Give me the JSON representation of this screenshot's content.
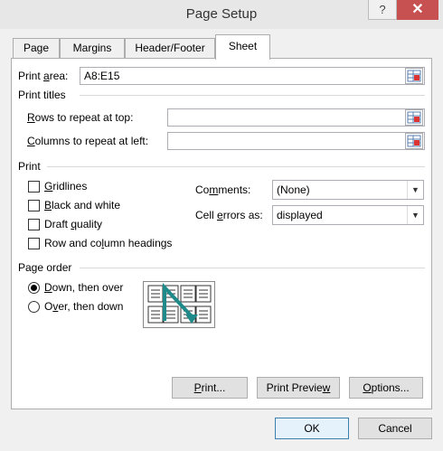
{
  "window": {
    "title": "Page Setup",
    "help_glyph": "?",
    "close_glyph": "✕"
  },
  "tabs": [
    {
      "label": "Page"
    },
    {
      "label": "Margins"
    },
    {
      "label": "Header/Footer"
    },
    {
      "label": "Sheet",
      "active": true
    }
  ],
  "print_area": {
    "label_pre": "Print ",
    "label_u": "a",
    "label_post": "rea:",
    "value": "A8:E15"
  },
  "print_titles": {
    "heading": "Print titles",
    "rows": {
      "label_u": "R",
      "label_post": "ows to repeat at top:",
      "value": ""
    },
    "cols": {
      "label_u": "C",
      "label_post": "olumns to repeat at left:",
      "value": ""
    }
  },
  "print": {
    "heading": "Print",
    "gridlines": {
      "u": "G",
      "rest": "ridlines",
      "checked": false
    },
    "black_white": {
      "u": "B",
      "rest": "lack and white",
      "checked": false
    },
    "draft": {
      "pre": "Draft ",
      "u": "q",
      "rest": "uality",
      "checked": false
    },
    "headings": {
      "pre": "Row and co",
      "u": "l",
      "rest": "umn headings",
      "checked": false
    },
    "comments": {
      "pre": "Co",
      "u": "m",
      "rest": "ments:",
      "value": "(None)"
    },
    "cell_errors": {
      "pre": "Cell ",
      "u": "e",
      "rest": "rrors as:",
      "value": "displayed"
    }
  },
  "page_order": {
    "heading": "Page order",
    "down_over": {
      "u": "D",
      "rest": "own, then over",
      "selected": true
    },
    "over_down": {
      "pre": "O",
      "u": "v",
      "rest": "er, then down",
      "selected": false
    }
  },
  "buttons": {
    "print": {
      "u": "P",
      "rest": "rint..."
    },
    "preview": {
      "pre": "Print Previe",
      "u": "w",
      "rest": ""
    },
    "options": {
      "u": "O",
      "rest": "ptions..."
    },
    "ok": "OK",
    "cancel": "Cancel"
  },
  "colors": {
    "close_bg": "#c75050",
    "accent_arrow": "#1f8a8a"
  }
}
